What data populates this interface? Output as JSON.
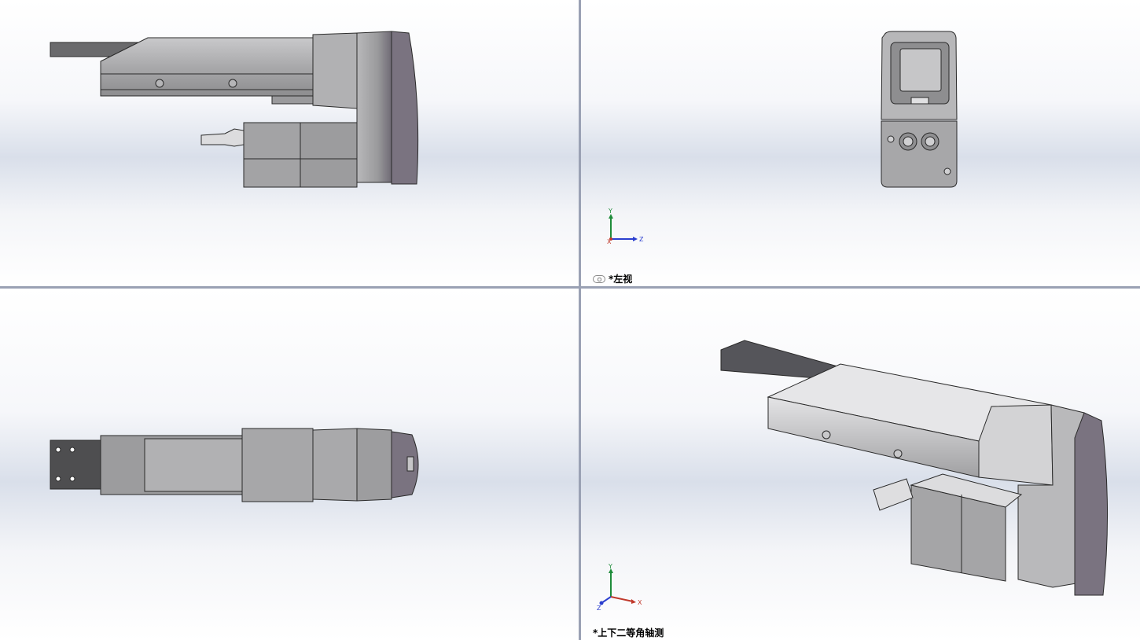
{
  "views": [
    {
      "id": "front",
      "label": ""
    },
    {
      "id": "left",
      "label": "*左视",
      "link_icon": "link-icon"
    },
    {
      "id": "top",
      "label": ""
    },
    {
      "id": "trimetric",
      "label": "*上下二等角轴测"
    }
  ],
  "triad_axes": {
    "x": "X",
    "y": "Y",
    "z": "Z"
  },
  "colors": {
    "viewport_bg": "#ffffff",
    "viewport_band": "#d9dfea",
    "splitter": "#9aa1b4",
    "axis_x": "#c0392b",
    "axis_y": "#1e8c3a",
    "axis_z": "#2b3fcf",
    "model_light": "#d4d4d6",
    "model_mid": "#a6a6a8",
    "model_dark": "#6e6e70",
    "model_purple": "#7a7380"
  }
}
